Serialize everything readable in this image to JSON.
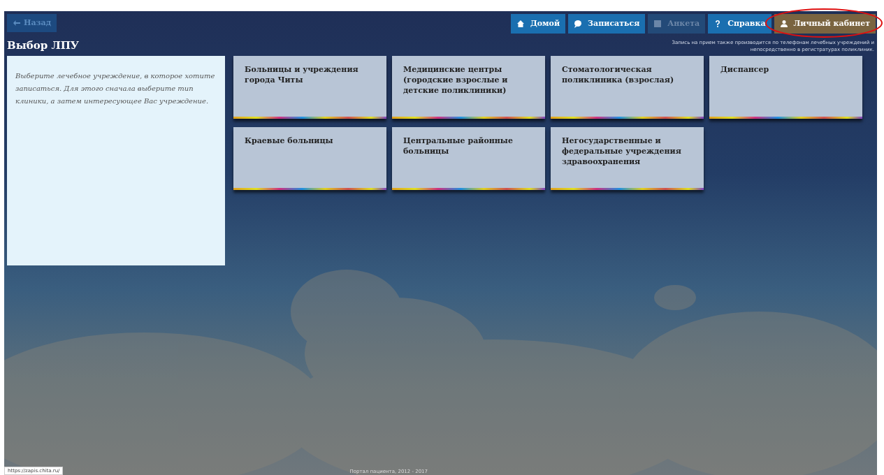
{
  "back_button": {
    "label": "Назад"
  },
  "nav_buttons": [
    {
      "label": "Домой",
      "kind": "primary"
    },
    {
      "label": "Записаться",
      "kind": "primary"
    },
    {
      "label": "Анкета",
      "kind": "disabled"
    },
    {
      "label": "Справка",
      "kind": "primary"
    },
    {
      "label": "Личный кабинет",
      "kind": "account",
      "circled": true
    }
  ],
  "page_title": "Выбор ЛПУ",
  "note": "Запись на прием также производится по телефонам лечебных учреждений и непосредственно в регистратурах поликлиник.",
  "hint": "Выберите лечебное учреждение, в которое хотите записаться. Для этого сначала выберите тип клиники, а затем интересующее Вас учреждение.",
  "categories": [
    {
      "label": "Больницы и учреждения города Читы"
    },
    {
      "label": "Медицинские центры (городские взрослые и детские поликлиники)"
    },
    {
      "label": "Стоматологическая поликлиника (взрослая)"
    },
    {
      "label": "Диспансер"
    },
    {
      "label": "Краевые больницы"
    },
    {
      "label": "Центральные районные больницы"
    },
    {
      "label": "Негосударственные и федеральные учреждения здравоохранения"
    }
  ],
  "footer": "Портал пациента, 2012 - 2017",
  "status_url": "https://zapis.chita.ru/"
}
